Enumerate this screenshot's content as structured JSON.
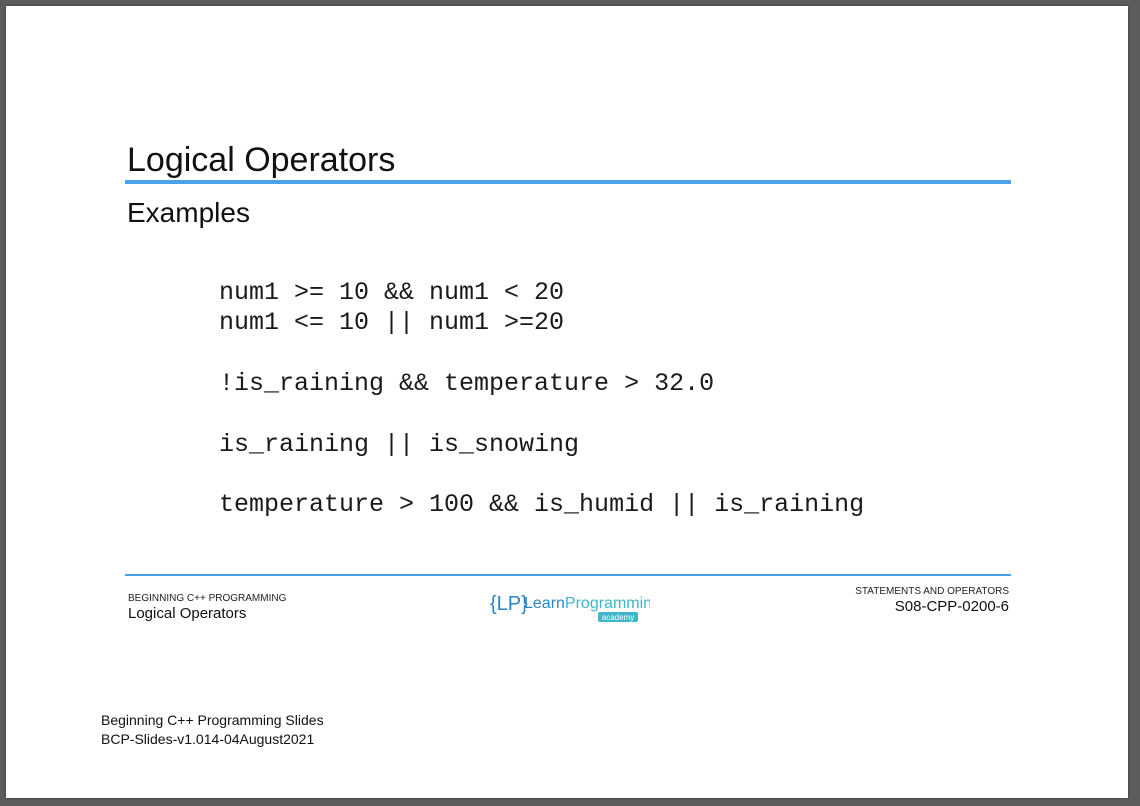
{
  "slide": {
    "title": "Logical Operators",
    "subtitle": "Examples",
    "code_lines": [
      "num1 >= 10 && num1 < 20",
      "num1 <= 10 || num1 >=20",
      "!is_raining && temperature > 32.0",
      "is_raining || is_snowing",
      "temperature > 100 && is_humid || is_raining"
    ]
  },
  "footer": {
    "course_label": "BEGINNING C++ PROGRAMMING",
    "topic": "Logical Operators",
    "section_label": "STATEMENTS AND OPERATORS",
    "slide_code": "S08-CPP-0200-6",
    "logo": {
      "brace_text": "{LP}",
      "name_part1": "Learn",
      "name_part2": "Programming",
      "tagline": "academy"
    }
  },
  "document_footer": {
    "line1": "Beginning C++ Programming Slides",
    "line2": "BCP-Slides-v1.014-04August2021"
  },
  "colors": {
    "accent_blue": "#4aa3ea",
    "logo_blue": "#2a86c9",
    "logo_teal": "#3fb6c9"
  }
}
